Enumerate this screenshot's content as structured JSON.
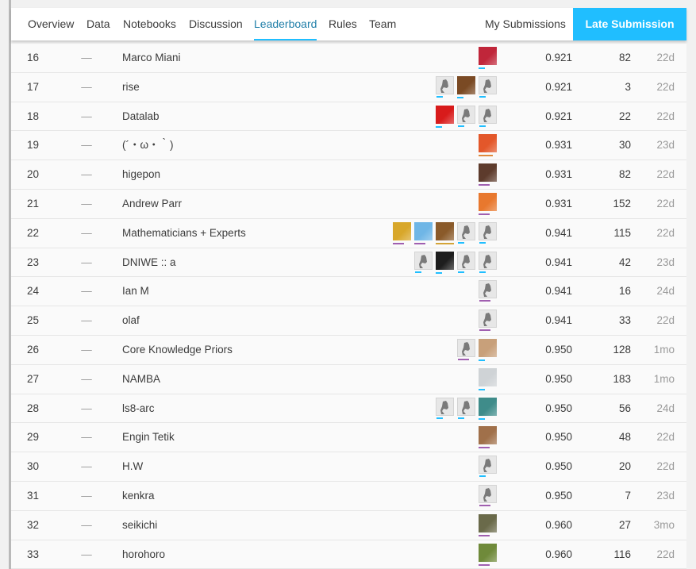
{
  "nav": {
    "tabs": [
      "Overview",
      "Data",
      "Notebooks",
      "Discussion",
      "Leaderboard",
      "Rules",
      "Team"
    ],
    "active_tab": "Leaderboard",
    "my_submissions": "My Submissions",
    "late_submission": "Late Submission"
  },
  "colors": {
    "accent": "#20beff",
    "active_text": "#1f7ea8"
  },
  "change_marker": "—",
  "rows": [
    {
      "rank": "16",
      "team": "Marco Miani",
      "score": "0.921",
      "entries": "82",
      "last": "22d",
      "members": [
        {
          "kind": "photo",
          "color": "#c0263a",
          "tier": "blue"
        }
      ]
    },
    {
      "rank": "17",
      "team": "rise",
      "score": "0.921",
      "entries": "3",
      "last": "22d",
      "members": [
        {
          "kind": "default",
          "tier": "blue"
        },
        {
          "kind": "photo",
          "color": "#7a4a24",
          "tier": "blue"
        },
        {
          "kind": "default",
          "tier": "blue"
        }
      ]
    },
    {
      "rank": "18",
      "team": "Datalab",
      "score": "0.921",
      "entries": "22",
      "last": "22d",
      "members": [
        {
          "kind": "photo",
          "color": "#d81b1b",
          "tier": "blue"
        },
        {
          "kind": "default",
          "tier": "blue"
        },
        {
          "kind": "default",
          "tier": "blue"
        }
      ]
    },
    {
      "rank": "19",
      "team": "(´・ω・｀)",
      "score": "0.931",
      "entries": "30",
      "last": "23d",
      "members": [
        {
          "kind": "photo",
          "color": "#e3572a",
          "tier": "orange"
        }
      ]
    },
    {
      "rank": "20",
      "team": "higepon",
      "score": "0.931",
      "entries": "82",
      "last": "22d",
      "members": [
        {
          "kind": "photo",
          "color": "#5d3b2c",
          "tier": "purple"
        }
      ]
    },
    {
      "rank": "21",
      "team": "Andrew Parr",
      "score": "0.931",
      "entries": "152",
      "last": "22d",
      "members": [
        {
          "kind": "photo",
          "color": "#e8782e",
          "tier": "purple"
        }
      ]
    },
    {
      "rank": "22",
      "team": "Mathematicians + Experts",
      "score": "0.941",
      "entries": "115",
      "last": "22d",
      "members": [
        {
          "kind": "photo",
          "color": "#d8a72a",
          "tier": "purple"
        },
        {
          "kind": "photo",
          "color": "#6fb6e6",
          "tier": "purple"
        },
        {
          "kind": "photo",
          "color": "#8a5a2a",
          "tier": "gold"
        },
        {
          "kind": "default",
          "tier": "blue"
        },
        {
          "kind": "default",
          "tier": "blue"
        }
      ]
    },
    {
      "rank": "23",
      "team": "DNIWE :: a",
      "score": "0.941",
      "entries": "42",
      "last": "23d",
      "members": [
        {
          "kind": "default",
          "tier": "blue"
        },
        {
          "kind": "photo",
          "color": "#1e1e1e",
          "tier": "blue"
        },
        {
          "kind": "default",
          "tier": "blue"
        },
        {
          "kind": "default",
          "tier": "blue"
        }
      ]
    },
    {
      "rank": "24",
      "team": "Ian M",
      "score": "0.941",
      "entries": "16",
      "last": "24d",
      "members": [
        {
          "kind": "default",
          "tier": "purple"
        }
      ]
    },
    {
      "rank": "25",
      "team": "olaf",
      "score": "0.941",
      "entries": "33",
      "last": "22d",
      "members": [
        {
          "kind": "default",
          "tier": "purple"
        }
      ]
    },
    {
      "rank": "26",
      "team": "Core Knowledge Priors",
      "score": "0.950",
      "entries": "128",
      "last": "1mo",
      "members": [
        {
          "kind": "default",
          "tier": "purple"
        },
        {
          "kind": "photo",
          "color": "#c8a07a",
          "tier": "blue"
        }
      ]
    },
    {
      "rank": "27",
      "team": "NAMBA",
      "score": "0.950",
      "entries": "183",
      "last": "1mo",
      "members": [
        {
          "kind": "photo",
          "color": "#cfd3d6",
          "tier": "blue"
        }
      ]
    },
    {
      "rank": "28",
      "team": "ls8-arc",
      "score": "0.950",
      "entries": "56",
      "last": "24d",
      "members": [
        {
          "kind": "default",
          "tier": "blue"
        },
        {
          "kind": "default",
          "tier": "blue"
        },
        {
          "kind": "photo",
          "color": "#3f8c8a",
          "tier": "blue"
        }
      ]
    },
    {
      "rank": "29",
      "team": "Engin Tetik",
      "score": "0.950",
      "entries": "48",
      "last": "22d",
      "members": [
        {
          "kind": "photo",
          "color": "#a0704a",
          "tier": "purple"
        }
      ]
    },
    {
      "rank": "30",
      "team": "H.W",
      "score": "0.950",
      "entries": "20",
      "last": "22d",
      "members": [
        {
          "kind": "default",
          "tier": "blue"
        }
      ]
    },
    {
      "rank": "31",
      "team": "kenkra",
      "score": "0.950",
      "entries": "7",
      "last": "23d",
      "members": [
        {
          "kind": "default",
          "tier": "purple"
        }
      ]
    },
    {
      "rank": "32",
      "team": "seikichi",
      "score": "0.960",
      "entries": "27",
      "last": "3mo",
      "members": [
        {
          "kind": "photo",
          "color": "#6a6a4a",
          "tier": "purple"
        }
      ]
    },
    {
      "rank": "33",
      "team": "horohoro",
      "score": "0.960",
      "entries": "116",
      "last": "22d",
      "members": [
        {
          "kind": "photo",
          "color": "#6f8a3a",
          "tier": "purple"
        }
      ]
    }
  ]
}
